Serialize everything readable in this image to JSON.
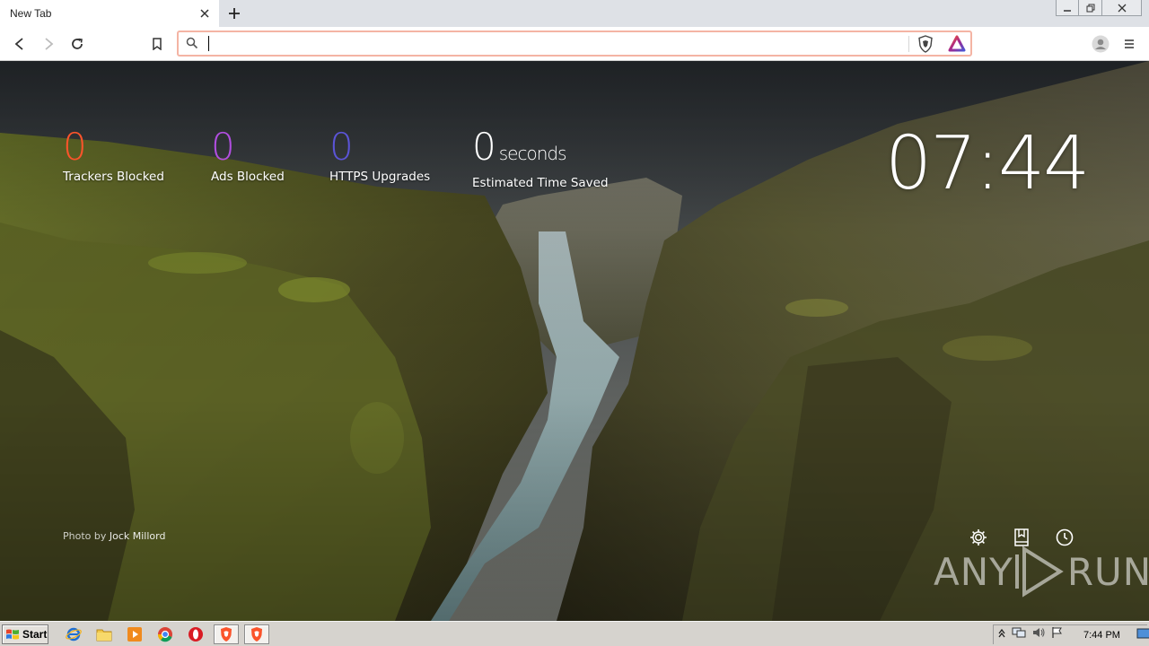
{
  "browser": {
    "tab": {
      "title": "New Tab"
    },
    "omnibox": {
      "value": "",
      "placeholder": ""
    }
  },
  "stats": {
    "trackers": {
      "value": "0",
      "label": "Trackers Blocked",
      "color": "#fb542b"
    },
    "ads": {
      "value": "0",
      "label": "Ads Blocked",
      "color": "#b14ee0"
    },
    "https": {
      "value": "0",
      "label": "HTTPS Upgrades",
      "color": "#5b54d6"
    },
    "time": {
      "value": "0",
      "unit": "seconds",
      "label": "Estimated Time Saved",
      "color": "#ffffff"
    }
  },
  "clock": {
    "time": "07:44"
  },
  "credit": {
    "prefix": "Photo by",
    "author": "Jock Millord"
  },
  "watermark": {
    "left": "ANY",
    "right": "RUN"
  },
  "taskbar": {
    "start_label": "Start",
    "clock": "7:44 PM"
  },
  "icons": {
    "tab_close": "close-icon",
    "new_tab": "plus-icon",
    "back": "back-arrow-icon",
    "forward": "forward-arrow-icon",
    "reload": "reload-icon",
    "bookmark": "bookmark-icon",
    "search": "search-icon",
    "shield": "brave-shield-icon",
    "rewards": "brave-rewards-icon",
    "profile": "profile-icon",
    "menu": "hamburger-menu-icon",
    "settings": "gear-icon",
    "bookmarks": "bookmarks-icon",
    "history": "history-icon"
  }
}
